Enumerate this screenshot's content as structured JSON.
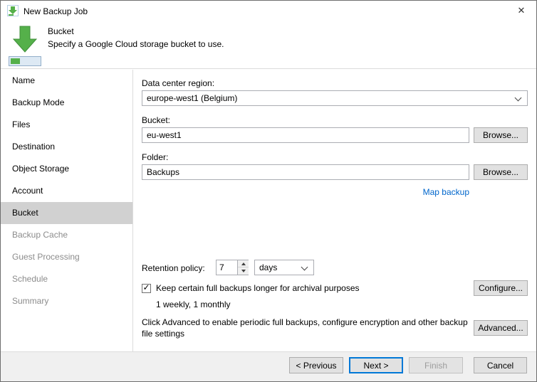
{
  "window": {
    "title": "New Backup Job",
    "close_glyph": "✕"
  },
  "header": {
    "title": "Bucket",
    "subtitle": "Specify a Google Cloud storage bucket to use."
  },
  "sidebar": {
    "items": [
      {
        "label": "Name"
      },
      {
        "label": "Backup Mode"
      },
      {
        "label": "Files"
      },
      {
        "label": "Destination"
      },
      {
        "label": "Object Storage"
      },
      {
        "label": "Account"
      },
      {
        "label": "Bucket"
      },
      {
        "label": "Backup Cache"
      },
      {
        "label": "Guest Processing"
      },
      {
        "label": "Schedule"
      },
      {
        "label": "Summary"
      }
    ]
  },
  "form": {
    "region_label": "Data center region:",
    "region_value": "europe-west1 (Belgium)",
    "bucket_label": "Bucket:",
    "bucket_value": "eu-west1",
    "bucket_browse": "Browse...",
    "folder_label": "Folder:",
    "folder_value": "Backups",
    "folder_browse": "Browse...",
    "map_backup_link": "Map backup",
    "retention_label": "Retention policy:",
    "retention_value": "7",
    "retention_unit": "days",
    "keep_checkbox_label": "Keep certain full backups longer for archival purposes",
    "keep_detail": "1 weekly, 1 monthly",
    "configure_button": "Configure...",
    "advanced_text": "Click Advanced to enable periodic full backups, configure encryption and other backup file settings",
    "advanced_button": "Advanced..."
  },
  "footer": {
    "previous": "< Previous",
    "next": "Next >",
    "finish": "Finish",
    "cancel": "Cancel"
  },
  "colors": {
    "accent_green": "#55b04a",
    "focus_blue": "#0078d7",
    "link_blue": "#0066cc",
    "sidebar_selected": "#d1d1d1"
  }
}
